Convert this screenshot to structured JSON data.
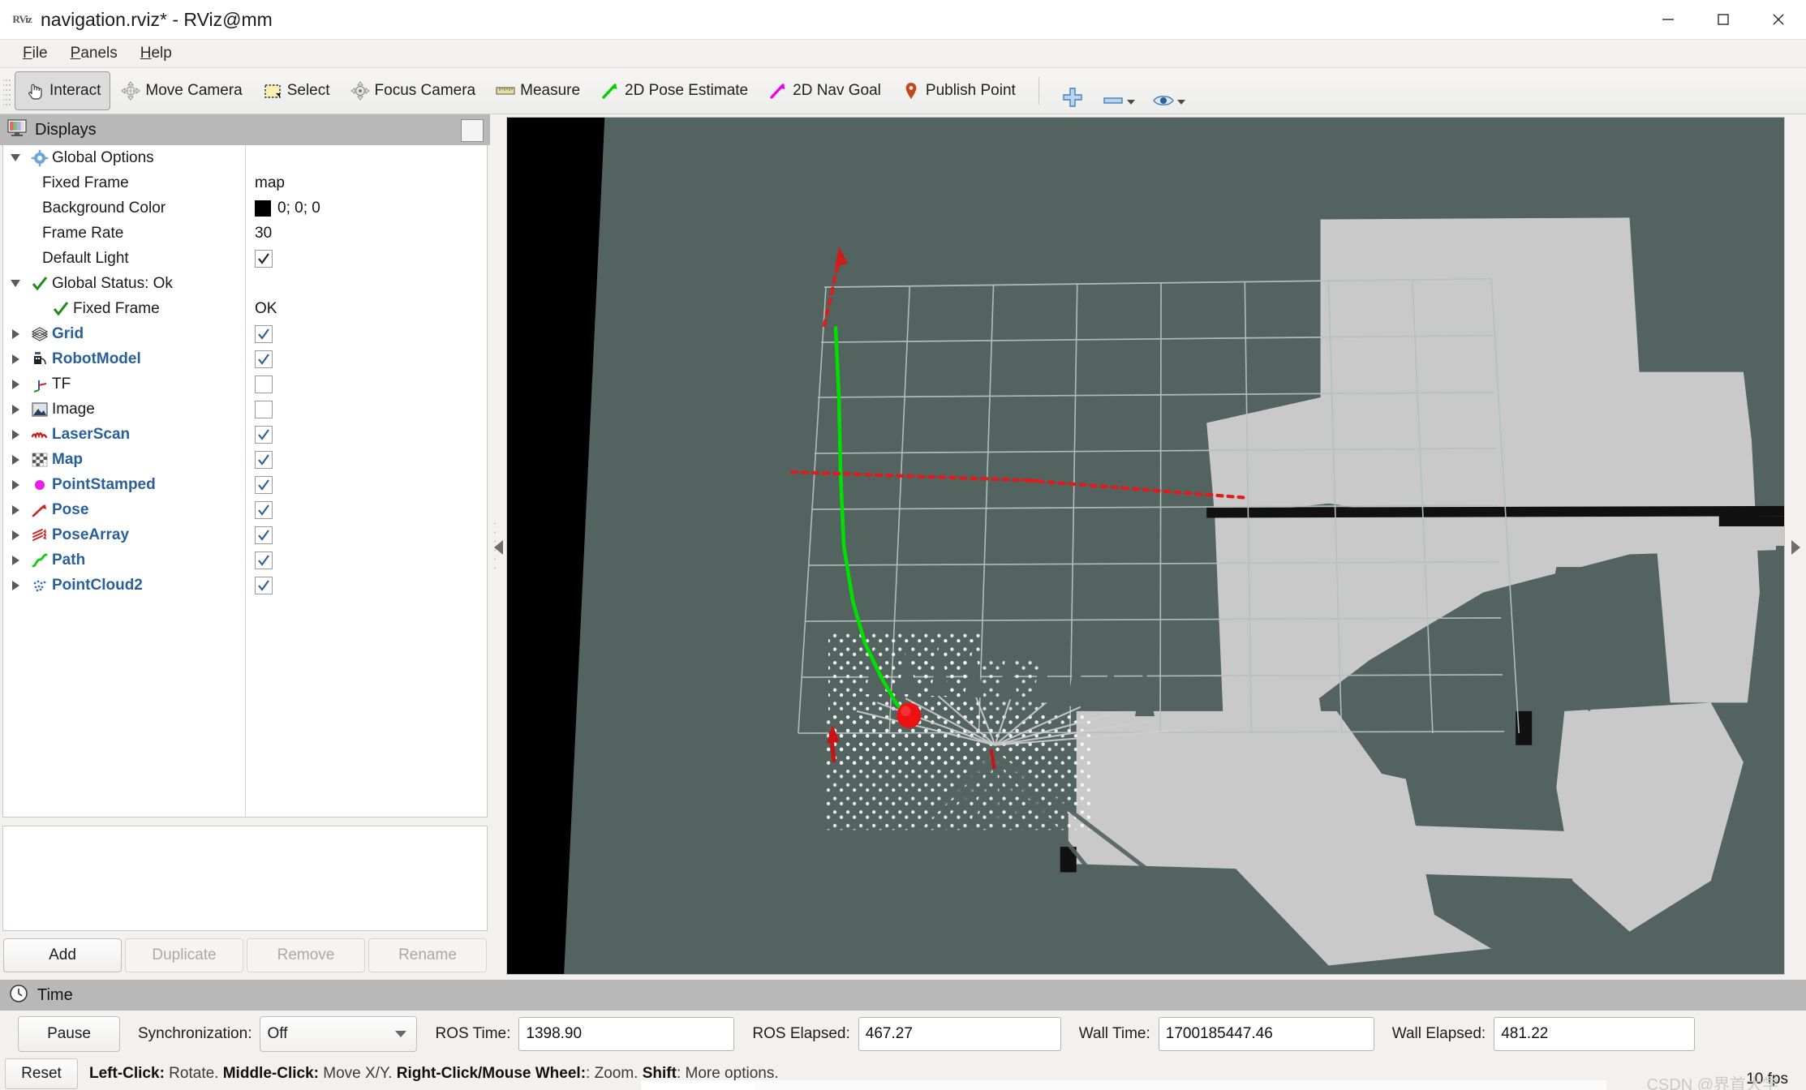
{
  "window": {
    "title": "navigation.rviz* - RViz@mm",
    "app_icon": "rviz-icon",
    "minimize_label": "minimize-icon",
    "maximize_label": "maximize-icon",
    "close_label": "close-icon"
  },
  "menubar": {
    "items": [
      {
        "accel": "F",
        "rest": "ile"
      },
      {
        "accel": "P",
        "rest": "anels"
      },
      {
        "accel": "H",
        "rest": "elp"
      }
    ]
  },
  "toolbar": {
    "buttons": [
      {
        "label": "Interact",
        "icon": "hand-cursor-icon",
        "active": true
      },
      {
        "label": "Move Camera",
        "icon": "move-camera-icon",
        "active": false
      },
      {
        "label": "Select",
        "icon": "select-rect-icon",
        "active": false
      },
      {
        "label": "Focus Camera",
        "icon": "focus-camera-icon",
        "active": false
      },
      {
        "label": "Measure",
        "icon": "ruler-icon",
        "active": false
      },
      {
        "label": "2D Pose Estimate",
        "icon": "green-arrow-icon",
        "active": false
      },
      {
        "label": "2D Nav Goal",
        "icon": "magenta-arrow-icon",
        "active": false
      },
      {
        "label": "Publish Point",
        "icon": "map-pin-icon",
        "active": false
      }
    ],
    "extra": [
      {
        "icon": "plus-icon",
        "caret": false
      },
      {
        "icon": "minus-icon",
        "caret": true
      },
      {
        "icon": "eye-icon",
        "caret": true
      }
    ]
  },
  "displays": {
    "panel_title": "Displays",
    "panel_icon": "displays-icon",
    "float_button": "float-panel-button",
    "tree": [
      {
        "depth": 0,
        "expander": "down",
        "icon": "gear-icon",
        "label": "Global Options",
        "bold": false,
        "value_type": "none",
        "value": ""
      },
      {
        "depth": 1,
        "expander": "none",
        "icon": "none",
        "label": "Fixed Frame",
        "bold": false,
        "value_type": "text",
        "value": "map"
      },
      {
        "depth": 1,
        "expander": "none",
        "icon": "none",
        "label": "Background Color",
        "bold": false,
        "value_type": "color",
        "value": "0; 0; 0",
        "color": "#000000"
      },
      {
        "depth": 1,
        "expander": "none",
        "icon": "none",
        "label": "Frame Rate",
        "bold": false,
        "value_type": "text",
        "value": "30"
      },
      {
        "depth": 1,
        "expander": "none",
        "icon": "none",
        "label": "Default Light",
        "bold": false,
        "value_type": "checkbox",
        "checked": true
      },
      {
        "depth": 0,
        "expander": "down",
        "icon": "check-ok-icon",
        "label": "Global Status: Ok",
        "bold": false,
        "value_type": "none",
        "value": ""
      },
      {
        "depth": 1,
        "expander": "none",
        "icon": "check-ok-icon",
        "label": "Fixed Frame",
        "bold": false,
        "value_type": "text",
        "value": "OK"
      },
      {
        "depth": 0,
        "expander": "right",
        "icon": "grid-icon",
        "label": "Grid",
        "bold": true,
        "value_type": "checkbox",
        "checked": true
      },
      {
        "depth": 0,
        "expander": "right",
        "icon": "robot-icon",
        "label": "RobotModel",
        "bold": true,
        "value_type": "checkbox",
        "checked": true
      },
      {
        "depth": 0,
        "expander": "right",
        "icon": "tf-axes-icon",
        "label": "TF",
        "bold": false,
        "value_type": "checkbox",
        "checked": false
      },
      {
        "depth": 0,
        "expander": "right",
        "icon": "image-icon",
        "label": "Image",
        "bold": false,
        "value_type": "checkbox",
        "checked": false
      },
      {
        "depth": 0,
        "expander": "right",
        "icon": "laserscan-icon",
        "label": "LaserScan",
        "bold": true,
        "value_type": "checkbox",
        "checked": true
      },
      {
        "depth": 0,
        "expander": "right",
        "icon": "map-grid-icon",
        "label": "Map",
        "bold": true,
        "value_type": "checkbox",
        "checked": true
      },
      {
        "depth": 0,
        "expander": "right",
        "icon": "point-stamped-icon",
        "label": "PointStamped",
        "bold": true,
        "value_type": "checkbox",
        "checked": true
      },
      {
        "depth": 0,
        "expander": "right",
        "icon": "pose-arrow-icon",
        "label": "Pose",
        "bold": true,
        "value_type": "checkbox",
        "checked": true
      },
      {
        "depth": 0,
        "expander": "right",
        "icon": "pose-array-icon",
        "label": "PoseArray",
        "bold": true,
        "value_type": "checkbox",
        "checked": true
      },
      {
        "depth": 0,
        "expander": "right",
        "icon": "path-icon",
        "label": "Path",
        "bold": true,
        "value_type": "checkbox",
        "checked": true
      },
      {
        "depth": 0,
        "expander": "right",
        "icon": "pointcloud-icon",
        "label": "PointCloud2",
        "bold": true,
        "value_type": "checkbox",
        "checked": true
      }
    ],
    "buttons": [
      {
        "label": "Add",
        "disabled": false
      },
      {
        "label": "Duplicate",
        "disabled": true
      },
      {
        "label": "Remove",
        "disabled": true
      },
      {
        "label": "Rename",
        "disabled": true
      }
    ]
  },
  "viewport": {
    "background_color": "#53635f",
    "unknown_color": "#000000",
    "occupancy_free_color": "#c9c9c9",
    "grid_color": "#b9c2c0",
    "path_color": "#00e000",
    "pose_array_color": "#e01b1b",
    "point_color": "#ee1111",
    "laser_color": "#ffffff",
    "collapse_left_arrow": "collapse-left-arrow",
    "expand_right_arrow": "expand-right-arrow"
  },
  "time": {
    "panel_title": "Time",
    "panel_icon": "clock-icon",
    "pause_label": "Pause",
    "sync_label": "Synchronization:",
    "sync_value": "Off",
    "ros_time_label": "ROS Time:",
    "ros_time_value": "1398.90",
    "ros_elapsed_label": "ROS Elapsed:",
    "ros_elapsed_value": "467.27",
    "wall_time_label": "Wall Time:",
    "wall_time_value": "1700185447.46",
    "wall_elapsed_label": "Wall Elapsed:",
    "wall_elapsed_value": "481.22"
  },
  "statusbar": {
    "reset_label": "Reset",
    "hint_1_key": "Left-Click:",
    "hint_1_text": " Rotate. ",
    "hint_2_key": "Middle-Click:",
    "hint_2_text": " Move X/Y. ",
    "hint_3_key": "Right-Click/Mouse Wheel:",
    "hint_3_text": ": Zoom. ",
    "hint_4_key": "Shift",
    "hint_4_text": ": More options.",
    "fps": "10 fps",
    "watermark": "CSDN @界首大学"
  }
}
